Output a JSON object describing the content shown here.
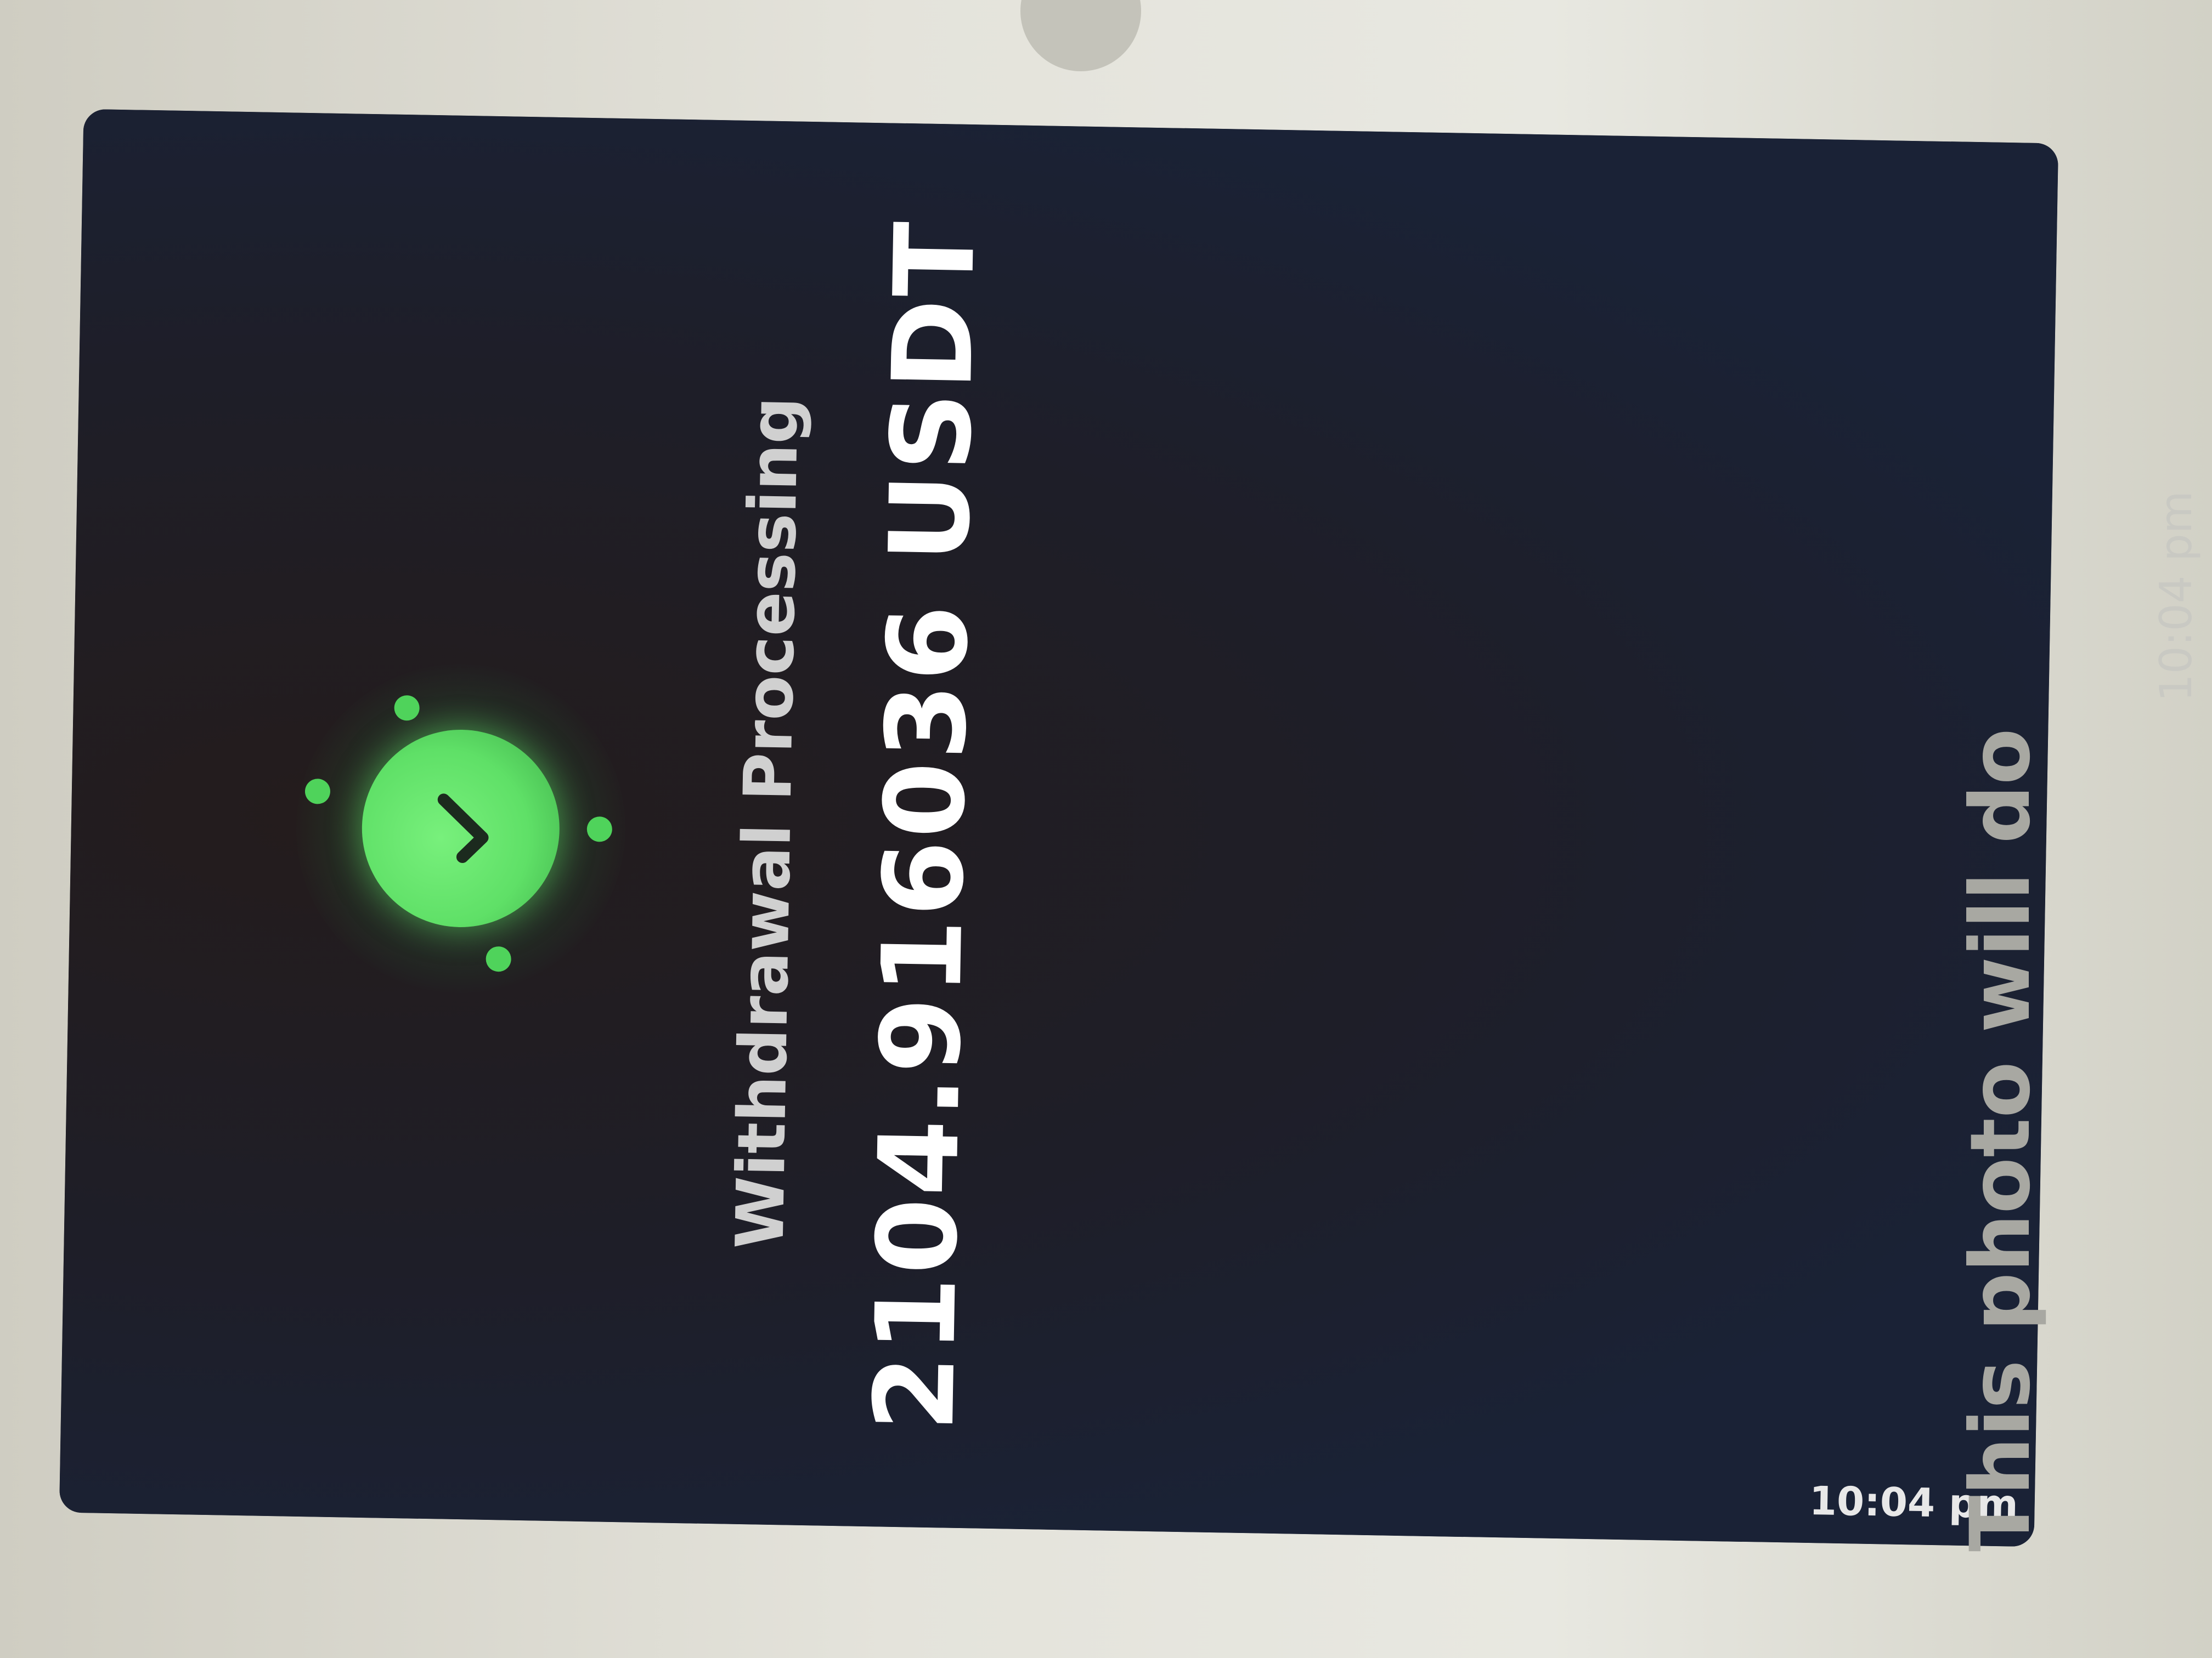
{
  "image_message": {
    "status_title": "Withdrawal Processing",
    "amount": "2104.9160",
    "currency": "36 USDT",
    "timestamp": "10:04 pm",
    "success_icon": "check-icon",
    "accent_color": "#5fe067",
    "background_color": "#202536"
  },
  "text_message": {
    "caption": "This photo will do",
    "timestamp": "10:04 pm"
  }
}
